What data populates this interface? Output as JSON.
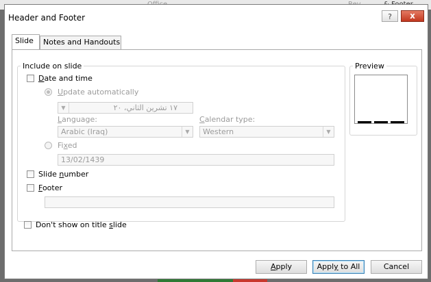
{
  "background": {
    "top_text_1": "Office",
    "top_text_2": "Rev",
    "top_text_3": "& Footer"
  },
  "dialog": {
    "title": "Header and Footer",
    "help_label": "?",
    "close_label": "x"
  },
  "tabs": [
    {
      "label": "Slide",
      "active": true
    },
    {
      "label": "Notes and Handouts",
      "active": false
    }
  ],
  "include_group": {
    "label": "Include on slide",
    "date_time": {
      "label_pre": "",
      "label_u": "D",
      "label_post": "ate and time",
      "checked": false
    },
    "update_auto": {
      "label_pre": "",
      "label_u": "U",
      "label_post": "pdate automatically",
      "selected": true
    },
    "date_value": "١٧ تشرين الثاني، ٢٠",
    "language": {
      "label_pre": "",
      "label_u": "L",
      "label_post": "anguage:",
      "value": "Arabic (Iraq)"
    },
    "calendar": {
      "label_pre": "",
      "label_u": "C",
      "label_post": "alendar type:",
      "value": "Western"
    },
    "fixed": {
      "label_pre": "Fi",
      "label_u": "x",
      "label_post": "ed",
      "selected": false,
      "value": "13/02/1439"
    },
    "slide_number": {
      "label_pre": "Slide ",
      "label_u": "n",
      "label_post": "umber",
      "checked": false
    },
    "footer": {
      "label_pre": "",
      "label_u": "F",
      "label_post": "ooter",
      "checked": false,
      "value": ""
    }
  },
  "dont_show": {
    "label_pre": "Don't show on title ",
    "label_u": "s",
    "label_post": "lide",
    "checked": false
  },
  "preview": {
    "label": "Preview"
  },
  "buttons": {
    "apply": {
      "pre": "",
      "u": "A",
      "post": "pply"
    },
    "apply_all": {
      "pre": "Appl",
      "u": "y",
      "post": " to All"
    },
    "cancel": "Cancel"
  },
  "colors": {
    "accent": "#3c7fb1",
    "close": "#c2381f"
  }
}
